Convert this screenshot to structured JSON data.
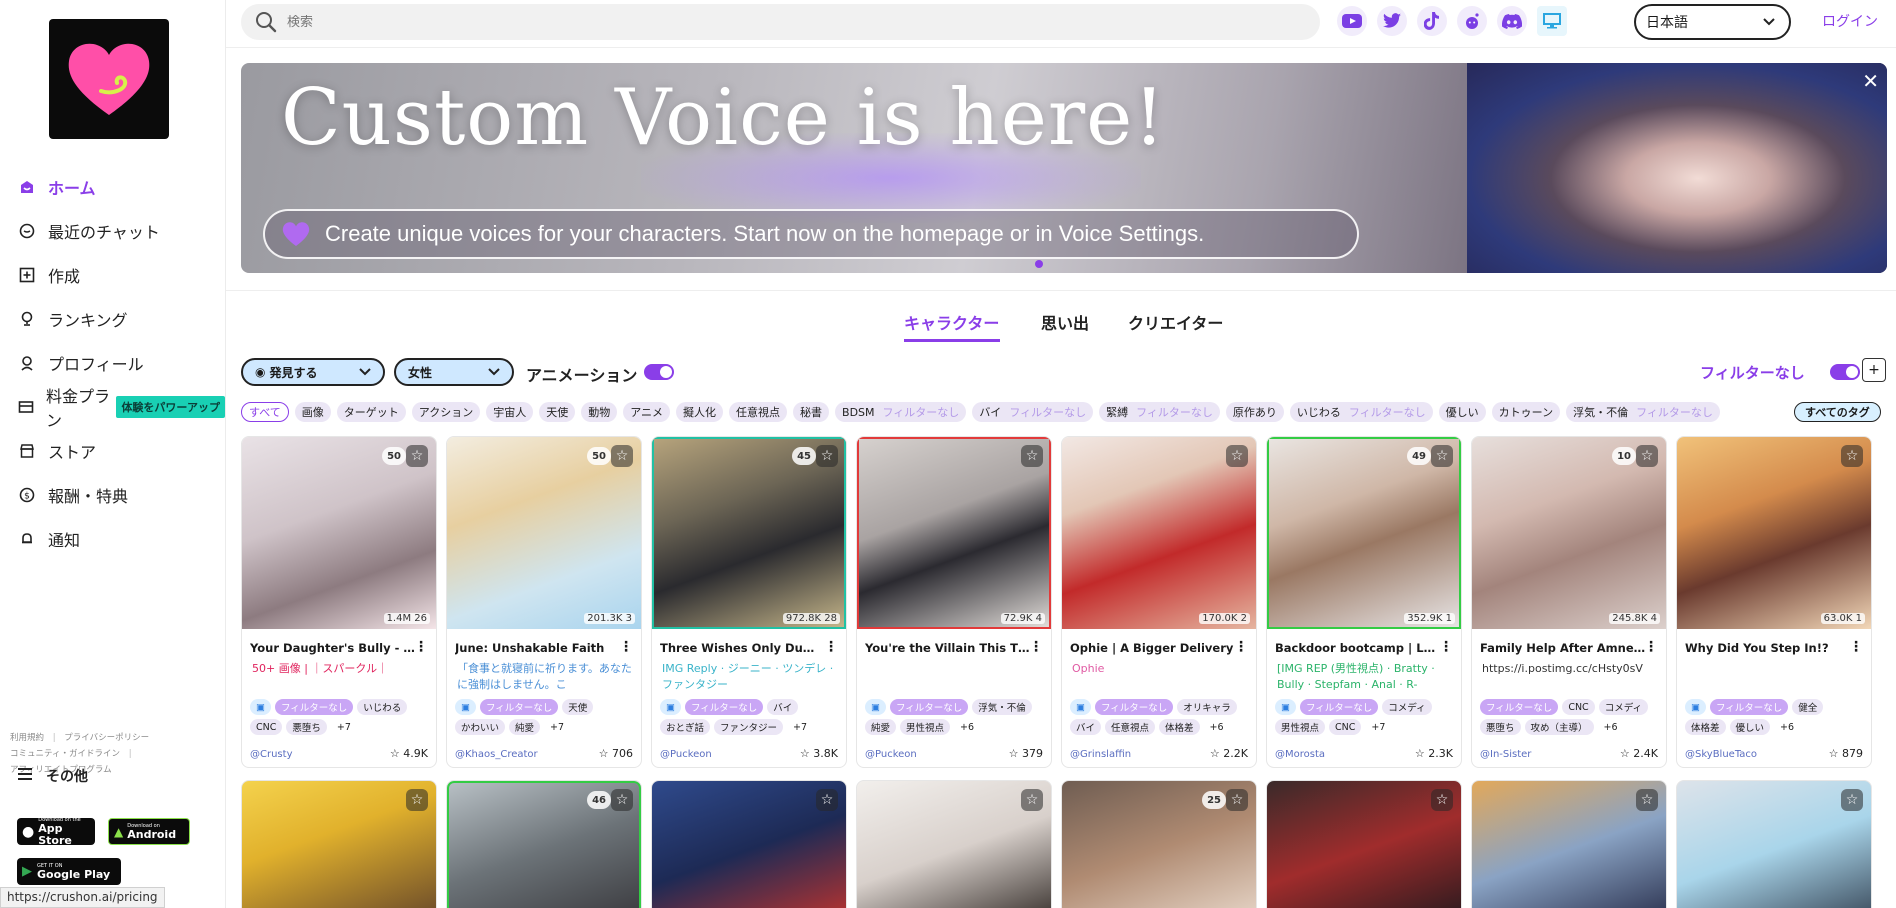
{
  "sidebar": {
    "nav": [
      {
        "label": "ホーム",
        "icon": "home-icon",
        "active": true
      },
      {
        "label": "最近のチャット",
        "icon": "chat-icon"
      },
      {
        "label": "作成",
        "icon": "plus-square-icon"
      },
      {
        "label": "ランキング",
        "icon": "trophy-icon"
      },
      {
        "label": "プロフィール",
        "icon": "profile-icon"
      },
      {
        "label": "料金プラン",
        "icon": "card-icon",
        "badge": "体験をパワーアップ"
      },
      {
        "label": "ストア",
        "icon": "store-icon"
      },
      {
        "label": "報酬・特典",
        "icon": "dollar-icon"
      },
      {
        "label": "通知",
        "icon": "bell-icon"
      }
    ],
    "legal": {
      "terms": "利用規約",
      "privacy": "プライバシーポリシー",
      "guidelines": "コミュニティ・ガイドライン",
      "affiliate": "アフィリエイトプログラム"
    },
    "other": "その他",
    "app_store": {
      "small": "Download on the",
      "big": "App Store"
    },
    "android": {
      "small": "Download on",
      "big": "Android"
    },
    "google_play": {
      "small": "GET IT ON",
      "big": "Google Play"
    },
    "status_url": "https://crushon.ai/pricing"
  },
  "header": {
    "search_placeholder": "検索",
    "language": "日本語",
    "login": "ログイン",
    "social_icons": [
      "youtube-icon",
      "twitter-icon",
      "tiktok-icon",
      "reddit-icon",
      "discord-icon",
      "desktop-icon"
    ]
  },
  "banner": {
    "headline": "Custom Voice is here!",
    "subtext": "Create unique voices for your characters. Start now on the homepage or in Voice Settings."
  },
  "tabs": [
    "キャラクター",
    "思い出",
    "クリエイター"
  ],
  "filters": {
    "discover": "発見する",
    "gender": "女性",
    "animation": "アニメーション",
    "no_filter": "フィルターなし",
    "all_tags": "すべてのタグ"
  },
  "tags": [
    {
      "label": "すべて",
      "outline": true
    },
    {
      "label": "画像"
    },
    {
      "label": "ターゲット"
    },
    {
      "label": "アクション"
    },
    {
      "label": "宇宙人"
    },
    {
      "label": "天使"
    },
    {
      "label": "動物"
    },
    {
      "label": "アニメ"
    },
    {
      "label": "擬人化"
    },
    {
      "label": "任意視点"
    },
    {
      "label": "秘書"
    },
    {
      "label": "BDSM",
      "nf": "フィルターなし"
    },
    {
      "label": "バイ",
      "nf": "フィルターなし"
    },
    {
      "label": "緊縛",
      "nf": "フィルターなし"
    },
    {
      "label": "原作あり"
    },
    {
      "label": "いじわる",
      "nf": "フィルターなし"
    },
    {
      "label": "優しい"
    },
    {
      "label": "カトゥーン"
    },
    {
      "label": "浮気・不倫",
      "nf": "フィルターなし"
    }
  ],
  "cards": [
    {
      "title": "Your Daughter's Bully - S...",
      "count": "50",
      "stats": "1.4M  26",
      "desc": "50+ 画像 | ｜スパークル｜",
      "desc_color": "#e0245e",
      "tags": [
        {
          "t": "img"
        },
        {
          "t": "フィルターなし",
          "nf": true
        },
        {
          "t": "いじわる"
        },
        {
          "t": "CNC"
        },
        {
          "t": "悪堕ち"
        },
        {
          "t": "+7",
          "plain": true
        }
      ],
      "author": "Crusty",
      "likes": "4.9K",
      "bg": "linear-gradient(160deg,#e9e2e6 0%,#cfc3c8 40%,#8d7b80 70%,#f4e5e8 100%)"
    },
    {
      "title": "June: Unshakable Faith",
      "count": "50",
      "stats": "201.3K  3",
      "desc": "「食事と就寝前に祈ります。あなたに強制はしません。こ",
      "desc_color": "#4a8fd6",
      "tags": [
        {
          "t": "img"
        },
        {
          "t": "フィルターなし",
          "nf": true
        },
        {
          "t": "天使"
        },
        {
          "t": "かわいい"
        },
        {
          "t": "純愛"
        },
        {
          "t": "+7",
          "plain": true
        }
      ],
      "author": "Khaos_Creator",
      "likes": "706",
      "bg": "linear-gradient(160deg,#f3ede0 0%,#e7cfa0 35%,#cfe5f0 70%,#a9d4ee 100%)"
    },
    {
      "title": "Three Wishes Only Dummy!",
      "count": "45",
      "stats": "972.8K  28",
      "desc": "IMG Reply · ジーニー · ツンデレ · ファンタジー",
      "desc_color": "#39b3c9",
      "tags": [
        {
          "t": "img"
        },
        {
          "t": "フィルターなし",
          "nf": true
        },
        {
          "t": "バイ"
        },
        {
          "t": "おとぎ話"
        },
        {
          "t": "ファンタジー"
        },
        {
          "t": "+7",
          "plain": true
        }
      ],
      "author": "Puckeon",
      "likes": "3.8K",
      "border": "teal",
      "bg": "linear-gradient(160deg,#b8a57d 0%,#6c6555 35%,#2a2a2e 60%,#c9b98c 100%)"
    },
    {
      "title": "You're the Villain This Time",
      "count": "",
      "stats": "72.9K  4",
      "desc": "",
      "desc_color": "#999",
      "tags": [
        {
          "t": "img"
        },
        {
          "t": "フィルターなし",
          "nf": true
        },
        {
          "t": "浮気・不倫"
        },
        {
          "t": "純愛"
        },
        {
          "t": "男性視点"
        },
        {
          "t": "+6",
          "plain": true
        }
      ],
      "author": "Puckeon",
      "likes": "379",
      "border": "red",
      "bg": "linear-gradient(160deg,#d7d2cf 0%,#a9a3a2 40%,#2b2a30 60%,#e6e1dd 100%)"
    },
    {
      "title": "Ophie | A Bigger Delivery",
      "count": "",
      "stats": "170.0K  2",
      "desc": "Ophie",
      "desc_color": "#e05aa3",
      "tags": [
        {
          "t": "img"
        },
        {
          "t": "フィルターなし",
          "nf": true
        },
        {
          "t": "オリキャラ"
        },
        {
          "t": "バイ"
        },
        {
          "t": "任意視点"
        },
        {
          "t": "体格差"
        },
        {
          "t": "+6",
          "plain": true
        }
      ],
      "author": "Grinslaffin",
      "likes": "2.2K",
      "bg": "linear-gradient(160deg,#f2e8e4 0%,#e3c7b6 30%,#c22a2a 60%,#e5b5a0 100%)"
    },
    {
      "title": "Backdoor bootcamp | Lara",
      "count": "49",
      "stats": "352.9K  1",
      "desc": "[IMG REP (男性視点) · Bratty · Bully · Stepfam · Anal · R-",
      "desc_color": "#2bb36a",
      "tags": [
        {
          "t": "img"
        },
        {
          "t": "フィルターなし",
          "nf": true
        },
        {
          "t": "コメディ"
        },
        {
          "t": "男性視点"
        },
        {
          "t": "CNC"
        },
        {
          "t": "+7",
          "plain": true
        }
      ],
      "author": "Morosta",
      "likes": "2.3K",
      "border": "green",
      "bg": "linear-gradient(160deg,#eae6e3 0%,#cfb7a7 35%,#9a7863 55%,#e9e7e8 100%)"
    },
    {
      "title": "Family Help After Amnesia",
      "count": "10",
      "stats": "245.8K  4",
      "desc": "https://i.postimg.cc/cHsty0sV",
      "desc_color": "#333",
      "tags": [
        {
          "t": "フィルターなし",
          "nf": true
        },
        {
          "t": "CNC"
        },
        {
          "t": "コメディ"
        },
        {
          "t": "悪堕ち"
        },
        {
          "t": "攻め（主導）"
        },
        {
          "t": "+6",
          "plain": true
        }
      ],
      "author": "In-Sister",
      "likes": "2.4K",
      "bg": "linear-gradient(160deg,#e7dfdc 0%,#d3b9b0 35%,#a3847c 60%,#dcd0cc 100%)"
    },
    {
      "title": "Why Did You Step In!?",
      "count": "",
      "stats": "63.0K  1",
      "desc": "",
      "desc_color": "#e05aa3",
      "tags": [
        {
          "t": "img"
        },
        {
          "t": "フィルターなし",
          "nf": true
        },
        {
          "t": "健全"
        },
        {
          "t": "体格差"
        },
        {
          "t": "優しい"
        },
        {
          "t": "+6",
          "plain": true
        }
      ],
      "author": "SkyBlueTaco",
      "likes": "879",
      "bg": "linear-gradient(160deg,#f1c27a 0%,#d48b4c 35%,#6a3a2e 60%,#f2d7b8 100%)"
    }
  ],
  "row2": [
    {
      "count": "",
      "bg": "linear-gradient(160deg,#f4d24d 0%,#e1b12c 40%,#6a4a2a 100%)"
    },
    {
      "count": "46",
      "border": "green",
      "bg": "linear-gradient(160deg,#b9c1c6 0%,#6c7378 50%,#3a3a3e 100%)"
    },
    {
      "count": "",
      "bg": "linear-gradient(160deg,#2f4a8c 0%,#1d2a55 50%,#b8332f 100%)"
    },
    {
      "count": "",
      "bg": "linear-gradient(160deg,#f2efec 0%,#d8d0cb 50%,#3a332f 100%)"
    },
    {
      "count": "25",
      "bg": "linear-gradient(160deg,#6f5d52 0%,#b08b72 50%,#e6d5c7 100%)"
    },
    {
      "count": "",
      "bg": "linear-gradient(160deg,#3a2a2a 0%,#a02c2c 50%,#2a1a1e 100%)"
    },
    {
      "count": "",
      "bg": "linear-gradient(160deg,#e2a85a 0%,#8aa3c4 50%,#2c3350 100%)"
    },
    {
      "count": "",
      "bg": "linear-gradient(160deg,#dde3ea 0%,#a9d5ea 50%,#3b4b5c 100%)"
    }
  ]
}
